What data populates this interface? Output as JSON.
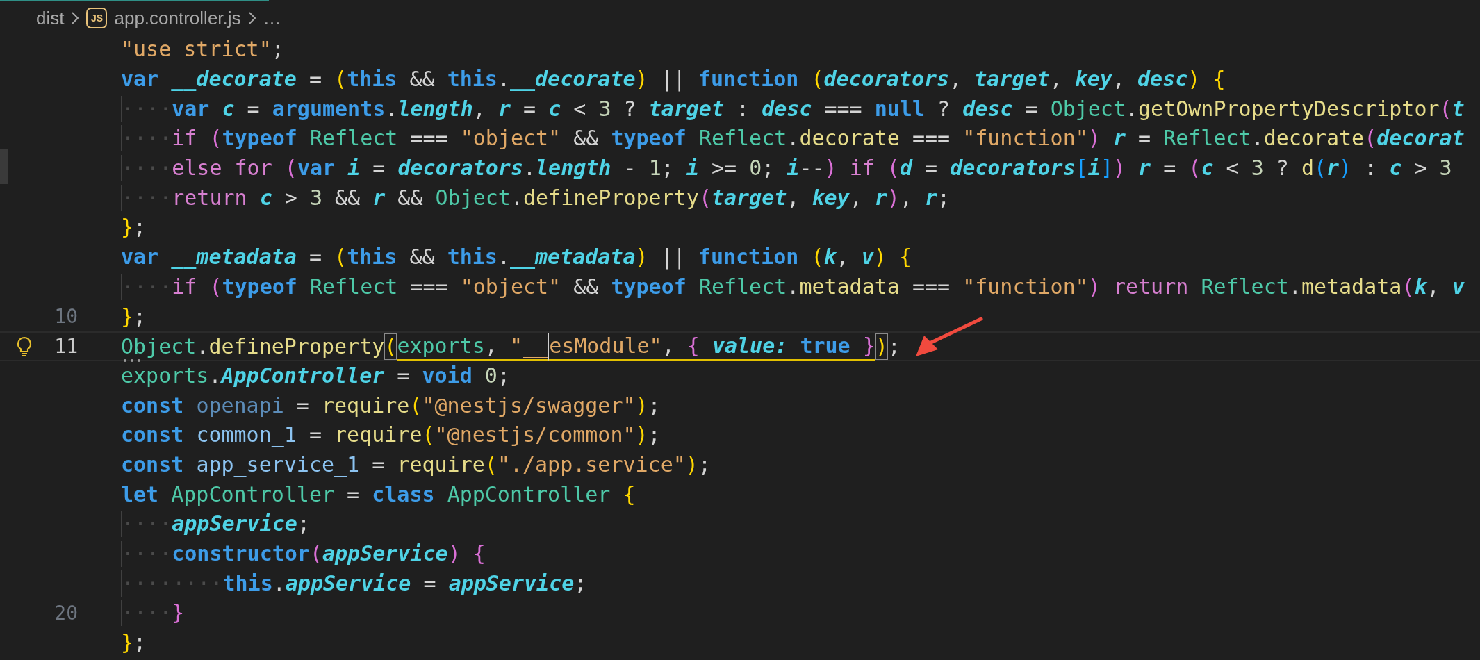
{
  "breadcrumb": [
    {
      "text": "dist"
    },
    {
      "text": "app.controller.js",
      "icon_text": "JS"
    },
    {
      "text": "…"
    }
  ],
  "editor": {
    "lines": [
      {
        "current": false,
        "tokens": [
          {
            "kind": "str",
            "text": "\"use strict\""
          },
          {
            "kind": "punc",
            "text": ";"
          }
        ]
      },
      {
        "current": false,
        "tokens": [
          {
            "kind": "kw",
            "text": "var "
          },
          {
            "kind": "param",
            "text": "__decorate"
          },
          {
            "kind": "punc",
            "text": " = "
          },
          {
            "kind": "b1",
            "text": "("
          },
          {
            "kind": "kw",
            "text": "this"
          },
          {
            "kind": "punc",
            "text": " && "
          },
          {
            "kind": "kw",
            "text": "this"
          },
          {
            "kind": "punc",
            "text": "."
          },
          {
            "kind": "param",
            "text": "__decorate"
          },
          {
            "kind": "b1",
            "text": ")"
          },
          {
            "kind": "punc",
            "text": " || "
          },
          {
            "kind": "kw",
            "text": "function "
          },
          {
            "kind": "b1",
            "text": "("
          },
          {
            "kind": "param",
            "text": "decorators"
          },
          {
            "kind": "punc",
            "text": ", "
          },
          {
            "kind": "param",
            "text": "target"
          },
          {
            "kind": "punc",
            "text": ", "
          },
          {
            "kind": "param",
            "text": "key"
          },
          {
            "kind": "punc",
            "text": ", "
          },
          {
            "kind": "param",
            "text": "desc"
          },
          {
            "kind": "b1",
            "text": ") "
          },
          {
            "kind": "b1",
            "text": "{"
          }
        ]
      },
      {
        "current": false,
        "tokens": [
          {
            "kind": "ws",
            "text": "····"
          },
          {
            "kind": "kw",
            "text": "var "
          },
          {
            "kind": "param",
            "text": "c"
          },
          {
            "kind": "punc",
            "text": " = "
          },
          {
            "kind": "kw",
            "text": "arguments"
          },
          {
            "kind": "punc",
            "text": "."
          },
          {
            "kind": "param",
            "text": "length"
          },
          {
            "kind": "punc",
            "text": ", "
          },
          {
            "kind": "param",
            "text": "r"
          },
          {
            "kind": "punc",
            "text": " = "
          },
          {
            "kind": "param",
            "text": "c"
          },
          {
            "kind": "punc",
            "text": " < "
          },
          {
            "kind": "num",
            "text": "3"
          },
          {
            "kind": "punc",
            "text": " ? "
          },
          {
            "kind": "param",
            "text": "target"
          },
          {
            "kind": "punc",
            "text": " : "
          },
          {
            "kind": "param",
            "text": "desc"
          },
          {
            "kind": "punc",
            "text": " === "
          },
          {
            "kind": "kw",
            "text": "null"
          },
          {
            "kind": "punc",
            "text": " ? "
          },
          {
            "kind": "param",
            "text": "desc"
          },
          {
            "kind": "punc",
            "text": " = "
          },
          {
            "kind": "type",
            "text": "Object"
          },
          {
            "kind": "punc",
            "text": "."
          },
          {
            "kind": "fn",
            "text": "getOwnPropertyDescriptor"
          },
          {
            "kind": "b2",
            "text": "("
          },
          {
            "kind": "param",
            "text": "t"
          }
        ]
      },
      {
        "current": false,
        "tokens": [
          {
            "kind": "ws",
            "text": "····"
          },
          {
            "kind": "ctrl",
            "text": "if "
          },
          {
            "kind": "b2",
            "text": "("
          },
          {
            "kind": "kw",
            "text": "typeof "
          },
          {
            "kind": "type",
            "text": "Reflect"
          },
          {
            "kind": "punc",
            "text": " === "
          },
          {
            "kind": "str",
            "text": "\"object\""
          },
          {
            "kind": "punc",
            "text": " && "
          },
          {
            "kind": "kw",
            "text": "typeof "
          },
          {
            "kind": "type",
            "text": "Reflect"
          },
          {
            "kind": "punc",
            "text": "."
          },
          {
            "kind": "fn",
            "text": "decorate"
          },
          {
            "kind": "punc",
            "text": " === "
          },
          {
            "kind": "str",
            "text": "\"function\""
          },
          {
            "kind": "b2",
            "text": ") "
          },
          {
            "kind": "param",
            "text": "r"
          },
          {
            "kind": "punc",
            "text": " = "
          },
          {
            "kind": "type",
            "text": "Reflect"
          },
          {
            "kind": "punc",
            "text": "."
          },
          {
            "kind": "fn",
            "text": "decorate"
          },
          {
            "kind": "b2",
            "text": "("
          },
          {
            "kind": "param",
            "text": "decorat"
          }
        ]
      },
      {
        "current": false,
        "tokens": [
          {
            "kind": "ws",
            "text": "····"
          },
          {
            "kind": "ctrl",
            "text": "else for "
          },
          {
            "kind": "b2",
            "text": "("
          },
          {
            "kind": "kw",
            "text": "var "
          },
          {
            "kind": "param",
            "text": "i"
          },
          {
            "kind": "punc",
            "text": " = "
          },
          {
            "kind": "param",
            "text": "decorators"
          },
          {
            "kind": "punc",
            "text": "."
          },
          {
            "kind": "param",
            "text": "length"
          },
          {
            "kind": "punc",
            "text": " - "
          },
          {
            "kind": "num",
            "text": "1"
          },
          {
            "kind": "punc",
            "text": "; "
          },
          {
            "kind": "param",
            "text": "i"
          },
          {
            "kind": "punc",
            "text": " >= "
          },
          {
            "kind": "num",
            "text": "0"
          },
          {
            "kind": "punc",
            "text": "; "
          },
          {
            "kind": "param",
            "text": "i"
          },
          {
            "kind": "punc",
            "text": "--"
          },
          {
            "kind": "b2",
            "text": ") "
          },
          {
            "kind": "ctrl",
            "text": "if "
          },
          {
            "kind": "b2",
            "text": "("
          },
          {
            "kind": "param",
            "text": "d"
          },
          {
            "kind": "punc",
            "text": " = "
          },
          {
            "kind": "param",
            "text": "decorators"
          },
          {
            "kind": "b3",
            "text": "["
          },
          {
            "kind": "param",
            "text": "i"
          },
          {
            "kind": "b3",
            "text": "]"
          },
          {
            "kind": "b2",
            "text": ") "
          },
          {
            "kind": "param",
            "text": "r"
          },
          {
            "kind": "punc",
            "text": " = "
          },
          {
            "kind": "b2",
            "text": "("
          },
          {
            "kind": "param",
            "text": "c"
          },
          {
            "kind": "punc",
            "text": " < "
          },
          {
            "kind": "num",
            "text": "3"
          },
          {
            "kind": "punc",
            "text": " ? "
          },
          {
            "kind": "fn",
            "text": "d"
          },
          {
            "kind": "b3",
            "text": "("
          },
          {
            "kind": "param",
            "text": "r"
          },
          {
            "kind": "b3",
            "text": ")"
          },
          {
            "kind": "punc",
            "text": " : "
          },
          {
            "kind": "param",
            "text": "c"
          },
          {
            "kind": "punc",
            "text": " > "
          },
          {
            "kind": "num",
            "text": "3"
          }
        ]
      },
      {
        "current": false,
        "tokens": [
          {
            "kind": "ws",
            "text": "····"
          },
          {
            "kind": "ctrl",
            "text": "return "
          },
          {
            "kind": "param",
            "text": "c"
          },
          {
            "kind": "punc",
            "text": " > "
          },
          {
            "kind": "num",
            "text": "3"
          },
          {
            "kind": "punc",
            "text": " && "
          },
          {
            "kind": "param",
            "text": "r"
          },
          {
            "kind": "punc",
            "text": " && "
          },
          {
            "kind": "type",
            "text": "Object"
          },
          {
            "kind": "punc",
            "text": "."
          },
          {
            "kind": "fn",
            "text": "defineProperty"
          },
          {
            "kind": "b2",
            "text": "("
          },
          {
            "kind": "param",
            "text": "target"
          },
          {
            "kind": "punc",
            "text": ", "
          },
          {
            "kind": "param",
            "text": "key"
          },
          {
            "kind": "punc",
            "text": ", "
          },
          {
            "kind": "param",
            "text": "r"
          },
          {
            "kind": "b2",
            "text": ")"
          },
          {
            "kind": "punc",
            "text": ", "
          },
          {
            "kind": "param",
            "text": "r"
          },
          {
            "kind": "punc",
            "text": ";"
          }
        ]
      },
      {
        "current": false,
        "tokens": [
          {
            "kind": "b1",
            "text": "}"
          },
          {
            "kind": "punc",
            "text": ";"
          }
        ]
      },
      {
        "current": false,
        "tokens": [
          {
            "kind": "kw",
            "text": "var "
          },
          {
            "kind": "param",
            "text": "__metadata"
          },
          {
            "kind": "punc",
            "text": " = "
          },
          {
            "kind": "b1",
            "text": "("
          },
          {
            "kind": "kw",
            "text": "this"
          },
          {
            "kind": "punc",
            "text": " && "
          },
          {
            "kind": "kw",
            "text": "this"
          },
          {
            "kind": "punc",
            "text": "."
          },
          {
            "kind": "param",
            "text": "__metadata"
          },
          {
            "kind": "b1",
            "text": ")"
          },
          {
            "kind": "punc",
            "text": " || "
          },
          {
            "kind": "kw",
            "text": "function "
          },
          {
            "kind": "b1",
            "text": "("
          },
          {
            "kind": "param",
            "text": "k"
          },
          {
            "kind": "punc",
            "text": ", "
          },
          {
            "kind": "param",
            "text": "v"
          },
          {
            "kind": "b1",
            "text": ") "
          },
          {
            "kind": "b1",
            "text": "{"
          }
        ]
      },
      {
        "current": false,
        "tokens": [
          {
            "kind": "ws",
            "text": "····"
          },
          {
            "kind": "ctrl",
            "text": "if "
          },
          {
            "kind": "b2",
            "text": "("
          },
          {
            "kind": "kw",
            "text": "typeof "
          },
          {
            "kind": "type",
            "text": "Reflect"
          },
          {
            "kind": "punc",
            "text": " === "
          },
          {
            "kind": "str",
            "text": "\"object\""
          },
          {
            "kind": "punc",
            "text": " && "
          },
          {
            "kind": "kw",
            "text": "typeof "
          },
          {
            "kind": "type",
            "text": "Reflect"
          },
          {
            "kind": "punc",
            "text": "."
          },
          {
            "kind": "fn",
            "text": "metadata"
          },
          {
            "kind": "punc",
            "text": " === "
          },
          {
            "kind": "str",
            "text": "\"function\""
          },
          {
            "kind": "b2",
            "text": ") "
          },
          {
            "kind": "ctrl",
            "text": "return "
          },
          {
            "kind": "type",
            "text": "Reflect"
          },
          {
            "kind": "punc",
            "text": "."
          },
          {
            "kind": "fn",
            "text": "metadata"
          },
          {
            "kind": "b2",
            "text": "("
          },
          {
            "kind": "param",
            "text": "k"
          },
          {
            "kind": "punc",
            "text": ", "
          },
          {
            "kind": "param",
            "text": "v"
          }
        ]
      },
      {
        "number": "10",
        "current": false,
        "tokens": [
          {
            "kind": "b1",
            "text": "}"
          },
          {
            "kind": "punc",
            "text": ";"
          }
        ]
      },
      {
        "number": "11",
        "current": true,
        "lightbulb": true,
        "tokens": [
          {
            "kind": "type",
            "text": "Object",
            "underlined": false,
            "caret_after": false
          },
          {
            "kind": "punc",
            "text": ".",
            "underlined": false,
            "caret_after": false
          },
          {
            "kind": "fn",
            "text": "defineProperty",
            "underlined": false,
            "caret_after": false
          },
          {
            "kind": "match",
            "text": "(",
            "underlined": false,
            "caret_after": false
          },
          {
            "kind": "type",
            "text": "exports",
            "underlined": true,
            "caret_after": false
          },
          {
            "kind": "punc",
            "text": ", ",
            "underlined": true,
            "caret_after": false
          },
          {
            "kind": "str",
            "text": "\"__",
            "underlined": true,
            "caret_after": true
          },
          {
            "kind": "str",
            "text": "esModule\"",
            "underlined": true,
            "caret_after": false
          },
          {
            "kind": "punc",
            "text": ", ",
            "underlined": true,
            "caret_after": false
          },
          {
            "kind": "b2",
            "text": "{ ",
            "underlined": true,
            "caret_after": false
          },
          {
            "kind": "param",
            "text": "value: ",
            "underlined": true,
            "caret_after": false
          },
          {
            "kind": "kw",
            "text": "true ",
            "underlined": true,
            "caret_after": false
          },
          {
            "kind": "b2",
            "text": "}",
            "underlined": true,
            "caret_after": false
          },
          {
            "kind": "match",
            "text": ")",
            "underlined": false,
            "caret_after": false
          },
          {
            "kind": "punc",
            "text": ";",
            "underlined": false,
            "caret_after": false
          }
        ]
      },
      {
        "current": false,
        "tokens": [
          {
            "kind": "type",
            "text": "exports"
          },
          {
            "kind": "punc",
            "text": "."
          },
          {
            "kind": "param",
            "text": "AppController"
          },
          {
            "kind": "punc",
            "text": " = "
          },
          {
            "kind": "kw",
            "text": "void "
          },
          {
            "kind": "num",
            "text": "0"
          },
          {
            "kind": "punc",
            "text": ";"
          }
        ]
      },
      {
        "current": false,
        "tokens": [
          {
            "kind": "kw",
            "text": "const "
          },
          {
            "kind": "unused",
            "text": "openapi"
          },
          {
            "kind": "punc",
            "text": " = "
          },
          {
            "kind": "fn",
            "text": "require"
          },
          {
            "kind": "b1",
            "text": "("
          },
          {
            "kind": "str",
            "text": "\"@nestjs/swagger\""
          },
          {
            "kind": "b1",
            "text": ")"
          },
          {
            "kind": "punc",
            "text": ";"
          }
        ]
      },
      {
        "current": false,
        "tokens": [
          {
            "kind": "kw",
            "text": "const "
          },
          {
            "kind": "var",
            "text": "common_1"
          },
          {
            "kind": "punc",
            "text": " = "
          },
          {
            "kind": "fn",
            "text": "require"
          },
          {
            "kind": "b1",
            "text": "("
          },
          {
            "kind": "str",
            "text": "\"@nestjs/common\""
          },
          {
            "kind": "b1",
            "text": ")"
          },
          {
            "kind": "punc",
            "text": ";"
          }
        ]
      },
      {
        "current": false,
        "tokens": [
          {
            "kind": "kw",
            "text": "const "
          },
          {
            "kind": "var",
            "text": "app_service_1"
          },
          {
            "kind": "punc",
            "text": " = "
          },
          {
            "kind": "fn",
            "text": "require"
          },
          {
            "kind": "b1",
            "text": "("
          },
          {
            "kind": "str",
            "text": "\"./app.service\""
          },
          {
            "kind": "b1",
            "text": ")"
          },
          {
            "kind": "punc",
            "text": ";"
          }
        ]
      },
      {
        "current": false,
        "tokens": [
          {
            "kind": "kw",
            "text": "let "
          },
          {
            "kind": "type",
            "text": "AppController"
          },
          {
            "kind": "punc",
            "text": " = "
          },
          {
            "kind": "kw",
            "text": "class "
          },
          {
            "kind": "type",
            "text": "AppController "
          },
          {
            "kind": "b1",
            "text": "{"
          }
        ]
      },
      {
        "current": false,
        "tokens": [
          {
            "kind": "ws",
            "text": "····"
          },
          {
            "kind": "param",
            "text": "appService"
          },
          {
            "kind": "punc",
            "text": ";"
          }
        ]
      },
      {
        "current": false,
        "tokens": [
          {
            "kind": "ws",
            "text": "····"
          },
          {
            "kind": "kw",
            "text": "constructor"
          },
          {
            "kind": "b2",
            "text": "("
          },
          {
            "kind": "param",
            "text": "appService"
          },
          {
            "kind": "b2",
            "text": ") "
          },
          {
            "kind": "b2",
            "text": "{"
          }
        ]
      },
      {
        "current": false,
        "tokens": [
          {
            "kind": "ws",
            "text": "····"
          },
          {
            "kind": "ws",
            "text": "····"
          },
          {
            "kind": "kw",
            "text": "this"
          },
          {
            "kind": "punc",
            "text": "."
          },
          {
            "kind": "param",
            "text": "appService"
          },
          {
            "kind": "punc",
            "text": " = "
          },
          {
            "kind": "param",
            "text": "appService"
          },
          {
            "kind": "punc",
            "text": ";"
          }
        ]
      },
      {
        "number": "20",
        "current": false,
        "tokens": [
          {
            "kind": "ws",
            "text": "····"
          },
          {
            "kind": "b2",
            "text": "}"
          }
        ]
      },
      {
        "current": false,
        "tokens": [
          {
            "kind": "b1",
            "text": "}"
          },
          {
            "kind": "punc",
            "text": ";"
          }
        ]
      }
    ]
  }
}
